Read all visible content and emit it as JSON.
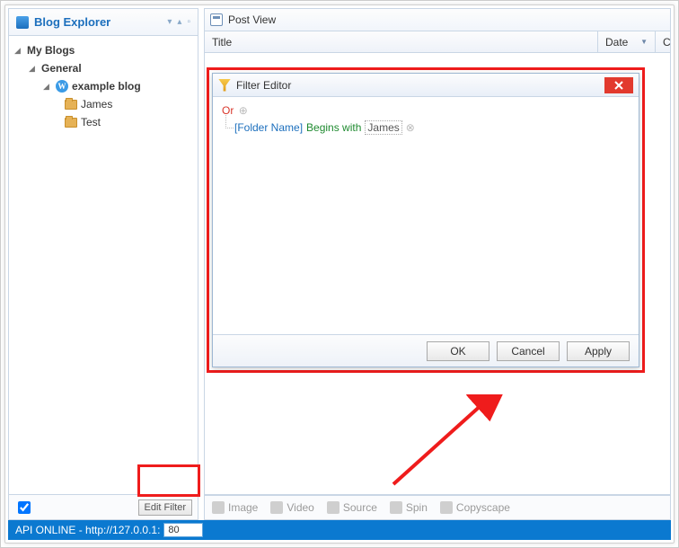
{
  "sidebar": {
    "title": "Blog Explorer",
    "root": "My Blogs",
    "group": "General",
    "blog": "example blog",
    "folders": [
      "James",
      "Test"
    ],
    "edit_filter": "Edit Filter"
  },
  "post_view": {
    "title": "Post View",
    "columns": {
      "title": "Title",
      "date": "Date"
    }
  },
  "filter_editor": {
    "title": "Filter Editor",
    "root_op": "Or",
    "field": "[Folder Name]",
    "operator": "Begins with",
    "value": "James",
    "buttons": {
      "ok": "OK",
      "cancel": "Cancel",
      "apply": "Apply"
    }
  },
  "toolbar": {
    "image": "Image",
    "video": "Video",
    "source": "Source",
    "spin": "Spin",
    "copyscape": "Copyscape"
  },
  "status": {
    "text": "API ONLINE - http://127.0.0.1:",
    "port": "80"
  },
  "chart_data": null
}
